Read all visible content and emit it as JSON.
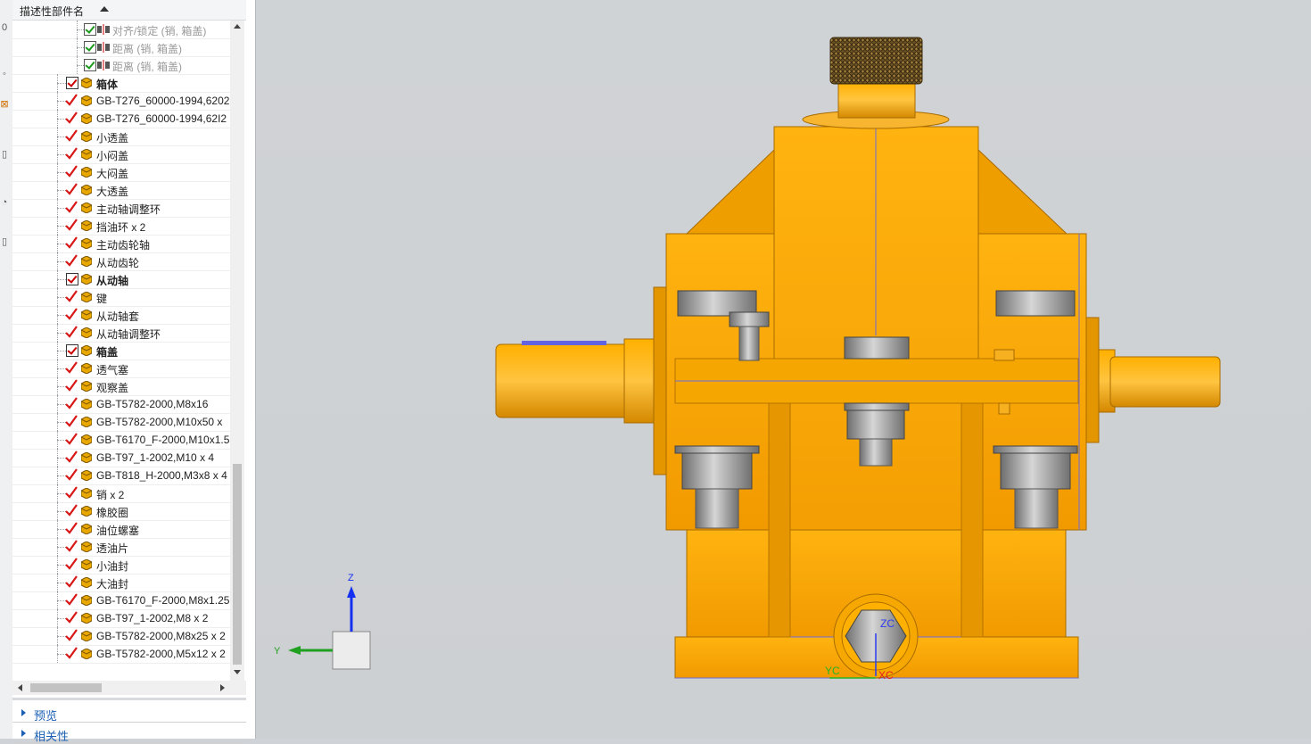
{
  "navigator": {
    "column_header": "描述性部件名",
    "constraints": [
      {
        "label": "对齐/锁定 (销, 箱盖)"
      },
      {
        "label": "距离 (销, 箱盖)"
      },
      {
        "label": "距离 (销, 箱盖)"
      }
    ],
    "components": [
      {
        "label": "箱体",
        "bold": true,
        "checkbox": true
      },
      {
        "label": "GB-T276_60000-1994,6202"
      },
      {
        "label": "GB-T276_60000-1994,62I2"
      },
      {
        "label": "小透盖"
      },
      {
        "label": "小闷盖"
      },
      {
        "label": "大闷盖"
      },
      {
        "label": "大透盖"
      },
      {
        "label": "主动轴调整环"
      },
      {
        "label": "挡油环 x 2"
      },
      {
        "label": "主动齿轮轴"
      },
      {
        "label": "从动齿轮"
      },
      {
        "label": "从动轴",
        "bold": true,
        "checkbox": true
      },
      {
        "label": "键"
      },
      {
        "label": "从动轴套"
      },
      {
        "label": "从动轴调整环"
      },
      {
        "label": "箱盖",
        "bold": true,
        "checkbox": true
      },
      {
        "label": "透气塞"
      },
      {
        "label": "观察盖"
      },
      {
        "label": "GB-T5782-2000,M8x16"
      },
      {
        "label": "GB-T5782-2000,M10x50 x"
      },
      {
        "label": "GB-T6170_F-2000,M10x1.5"
      },
      {
        "label": "GB-T97_1-2002,M10 x 4"
      },
      {
        "label": "GB-T818_H-2000,M3x8 x 4"
      },
      {
        "label": "销 x 2"
      },
      {
        "label": "橡胶圈"
      },
      {
        "label": "油位螺塞"
      },
      {
        "label": "透油片"
      },
      {
        "label": "小油封"
      },
      {
        "label": "大油封"
      },
      {
        "label": "GB-T6170_F-2000,M8x1.25"
      },
      {
        "label": "GB-T97_1-2002,M8 x 2"
      },
      {
        "label": "GB-T5782-2000,M8x25 x 2"
      },
      {
        "label": "GB-T5782-2000,M5x12 x 2"
      }
    ],
    "sections": [
      {
        "label": "预览"
      },
      {
        "label": "相关性"
      }
    ]
  },
  "triad": {
    "z": "Z",
    "y": "Y"
  },
  "wcs": {
    "zc": "ZC",
    "yc": "YC",
    "xc": "XC"
  },
  "colors": {
    "body": "#f6a400",
    "body_dark": "#c98300",
    "bolt": "#8e8e8e",
    "edge": "#6c6cd8",
    "bg": "#cfd2d6"
  }
}
